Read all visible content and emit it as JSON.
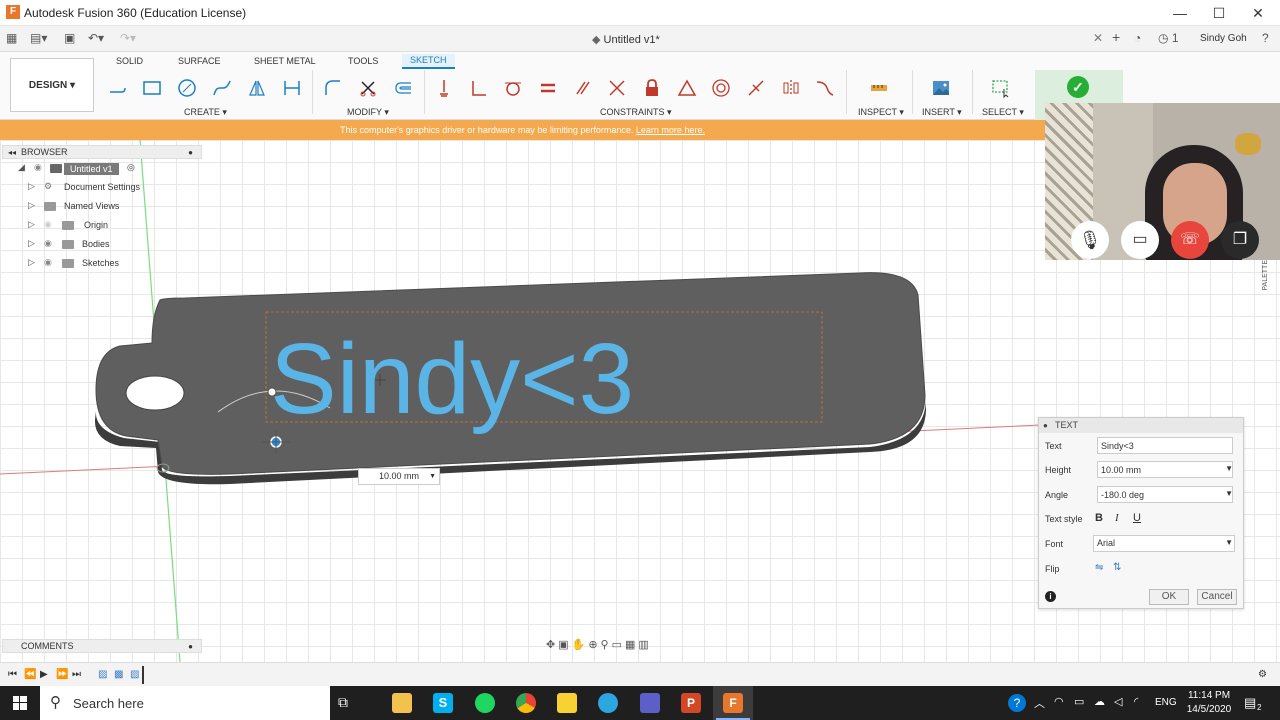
{
  "window": {
    "title": "Autodesk Fusion 360 (Education License)",
    "logo": "F",
    "minimize": "—",
    "maximize": "☐",
    "close": "✕"
  },
  "tabstrip": {
    "doc_title": "Untitled v1*",
    "notifications": "1",
    "user": "Sindy Goh"
  },
  "toolbar": {
    "workspace": "DESIGN ▾",
    "tabs": [
      "SOLID",
      "SURFACE",
      "SHEET METAL",
      "TOOLS",
      "SKETCH"
    ],
    "groups": {
      "create": "CREATE ▾",
      "modify": "MODIFY ▾",
      "constraints": "CONSTRAINTS ▾",
      "inspect": "INSPECT ▾",
      "insert": "INSERT ▾",
      "select": "SELECT ▾"
    }
  },
  "warning": {
    "text": "This computer's graphics driver or hardware may be limiting performance.",
    "link": "Learn more here."
  },
  "browser": {
    "title": "BROWSER",
    "root": "Untitled v1",
    "items": [
      "Document Settings",
      "Named Views",
      "Origin",
      "Bodies",
      "Sketches"
    ]
  },
  "comments": "COMMENTS",
  "model": {
    "text": "Sindy<3"
  },
  "dimension_input": "10.00 mm",
  "text_dialog": {
    "title": "TEXT",
    "text_label": "Text",
    "text_value": "Sindy<3",
    "height_label": "Height",
    "height_value": "10.00 mm",
    "angle_label": "Angle",
    "angle_value": "-180.0 deg",
    "style_label": "Text style",
    "bold": "B",
    "italic": "I",
    "underline": "U",
    "font_label": "Font",
    "font_value": "Arial",
    "flip_label": "Flip",
    "ok": "OK",
    "cancel": "Cancel"
  },
  "palette_label": "PALETTE",
  "taskbar": {
    "search_placeholder": "Search here",
    "lang": "ENG",
    "time": "11:14 PM",
    "date": "14/5/2020",
    "notification_count": "2"
  },
  "colors": {
    "accent": "#1a7fc4",
    "warning": "#f5a94e",
    "model_body": "#5f5f5f",
    "model_text": "#5ab4e5",
    "finish_green": "#27ae36",
    "hangup_red": "#e8453c"
  }
}
